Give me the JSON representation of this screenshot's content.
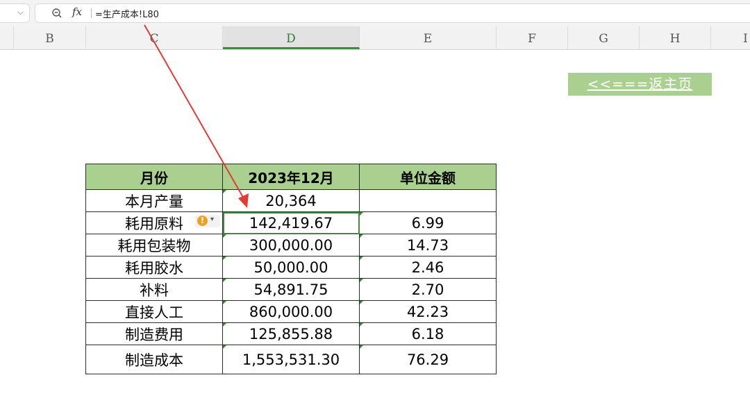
{
  "formula_bar": {
    "formula": "=生产成本!L80",
    "fx_label": "fx"
  },
  "columns": [
    "B",
    "C",
    "D",
    "E",
    "F",
    "G",
    "H",
    "I"
  ],
  "selected_column": "D",
  "return_button": "<<===返主页",
  "table": {
    "headers": [
      "月份",
      "2023年12月",
      "单位金额"
    ],
    "rows": [
      [
        "本月产量",
        "20,364",
        ""
      ],
      [
        "耗用原料",
        "142,419.67",
        "6.99"
      ],
      [
        "耗用包装物",
        "300,000.00",
        "14.73"
      ],
      [
        "耗用胶水",
        "50,000.00",
        "2.46"
      ],
      [
        "补料",
        "54,891.75",
        "2.70"
      ],
      [
        "直接人工",
        "860,000.00",
        "42.23"
      ],
      [
        "制造费用",
        "125,855.88",
        "6.18"
      ],
      [
        "制造成本",
        "1,553,531.30",
        "76.29"
      ]
    ]
  },
  "colors": {
    "header_green": "#a9d08e",
    "selection_green": "#3d8b3d",
    "arrow_red": "#e53935",
    "warning_orange": "#f0a020"
  }
}
